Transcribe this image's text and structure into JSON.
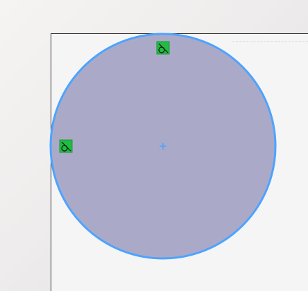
{
  "canvas": {
    "background_colors": [
      "#f6f4f2",
      "#eeecec",
      "#dedee2"
    ],
    "sheet_color": "#f5f5f6",
    "sheet_border_color": "#333333"
  },
  "circle": {
    "fill_color": "#aaaac8",
    "stroke_color": "#4da3ff"
  },
  "center_mark": {
    "icon": "plus-icon",
    "color": "#4da3ff"
  },
  "constraints": [
    {
      "name": "top-constraint",
      "icon": "tangent-constraint-icon",
      "color": "#22bb44"
    },
    {
      "name": "left-constraint",
      "icon": "tangent-constraint-icon",
      "color": "#22bb44"
    }
  ]
}
